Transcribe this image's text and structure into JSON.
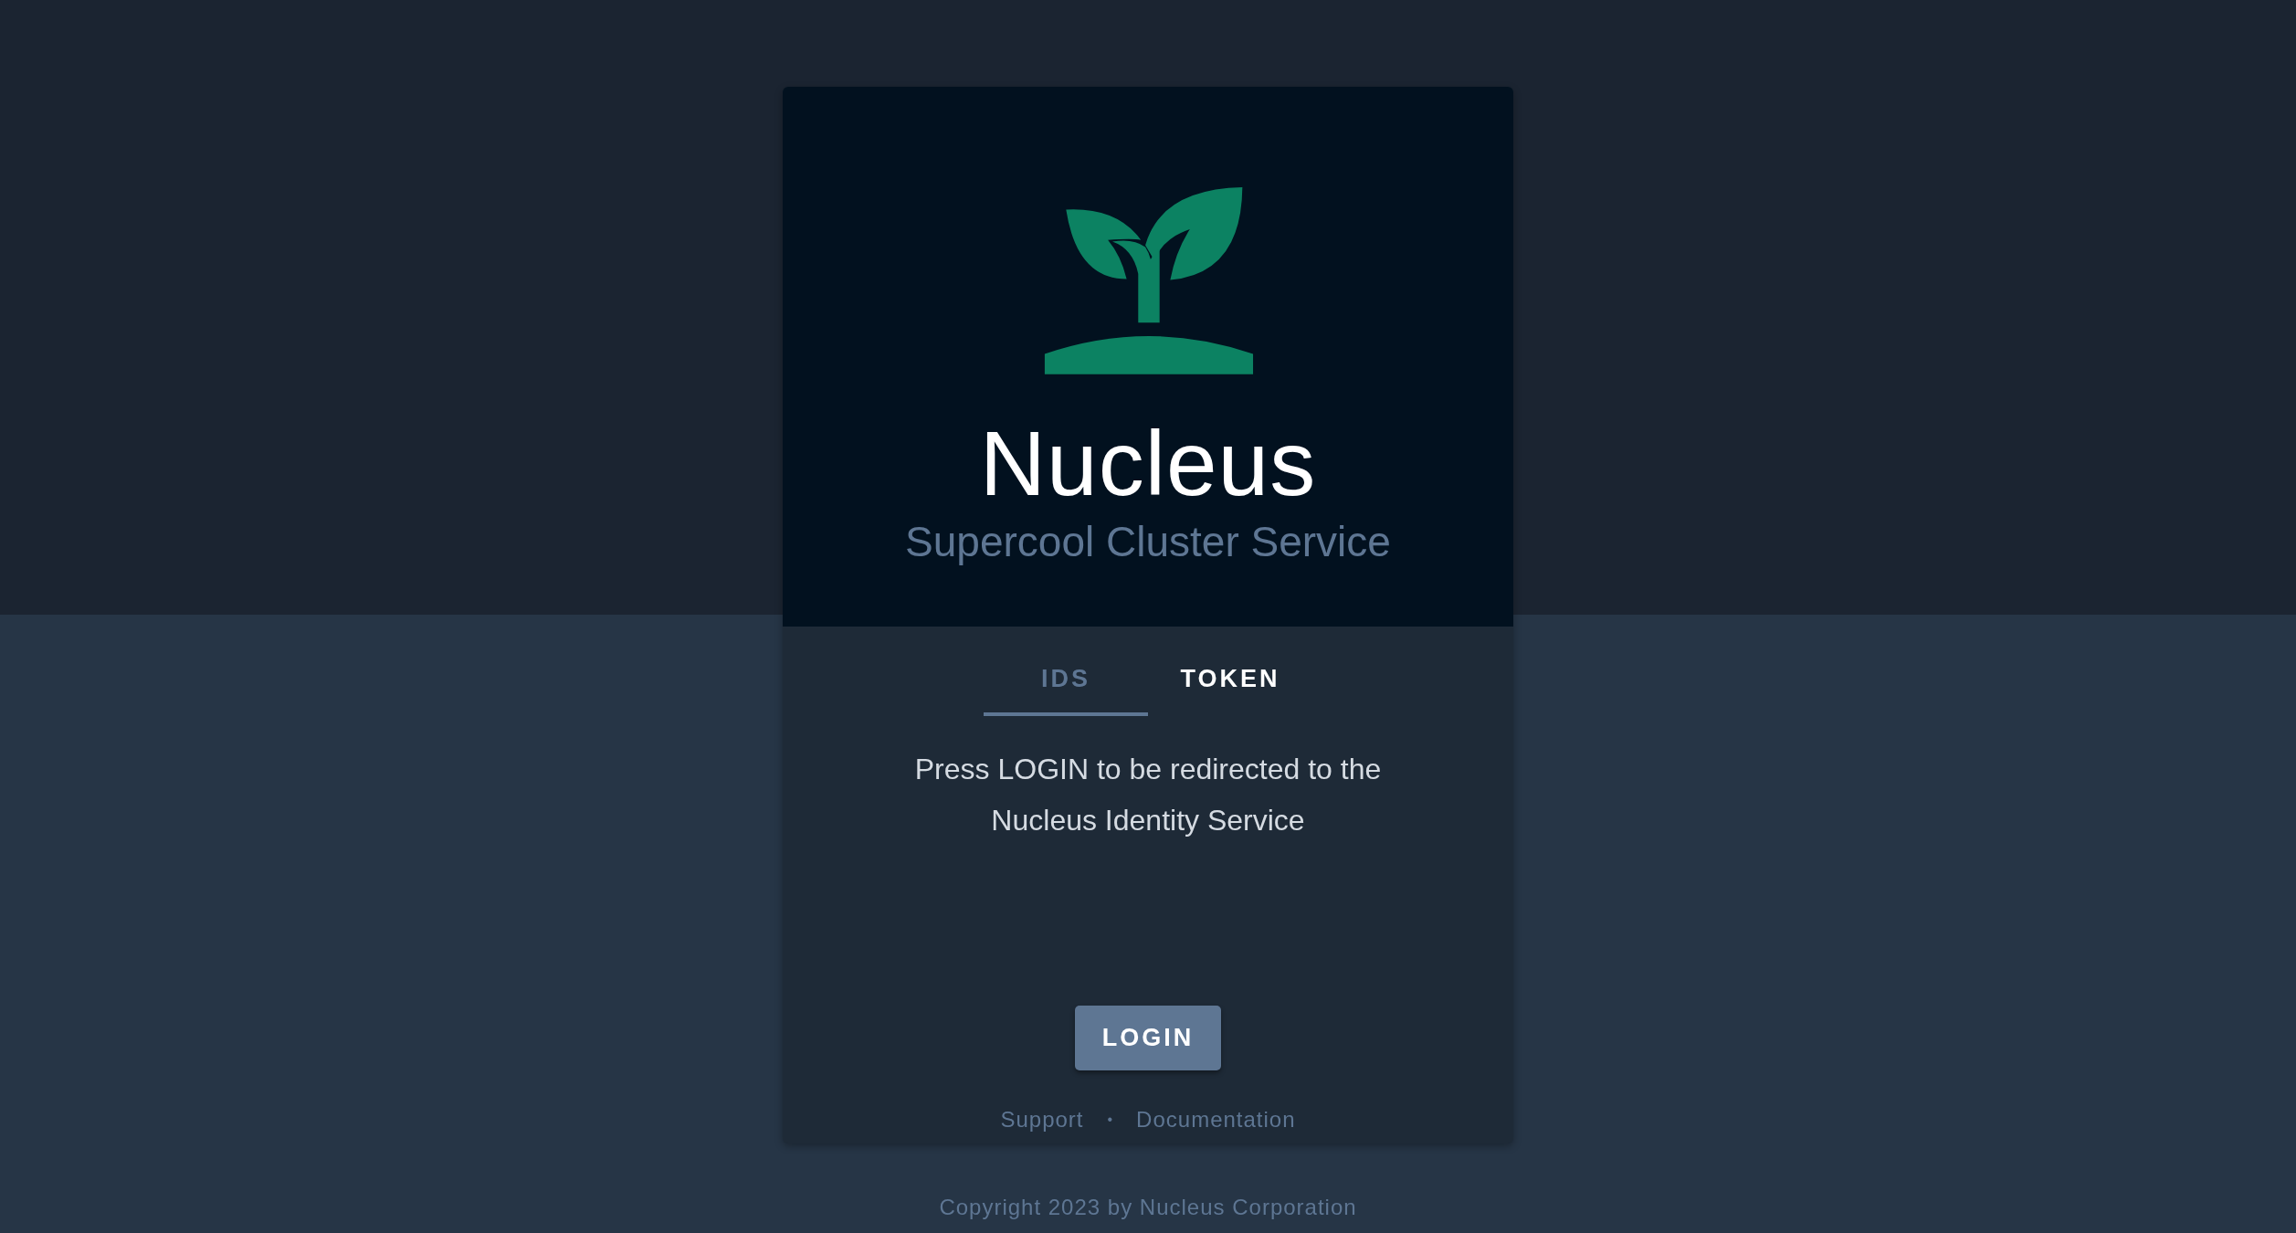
{
  "brand": {
    "title": "Nucleus",
    "subtitle": "Supercool Cluster Service"
  },
  "tabs": [
    {
      "label": "IDS",
      "selected": true
    },
    {
      "label": "TOKEN",
      "selected": false
    }
  ],
  "message": "Press LOGIN to be redirected to the Nucleus Identity Service",
  "login_button": "LOGIN",
  "footer_links": [
    "Support",
    "Documentation"
  ],
  "separator": "•",
  "copyright": "Copyright 2023 by Nucleus Corporation"
}
